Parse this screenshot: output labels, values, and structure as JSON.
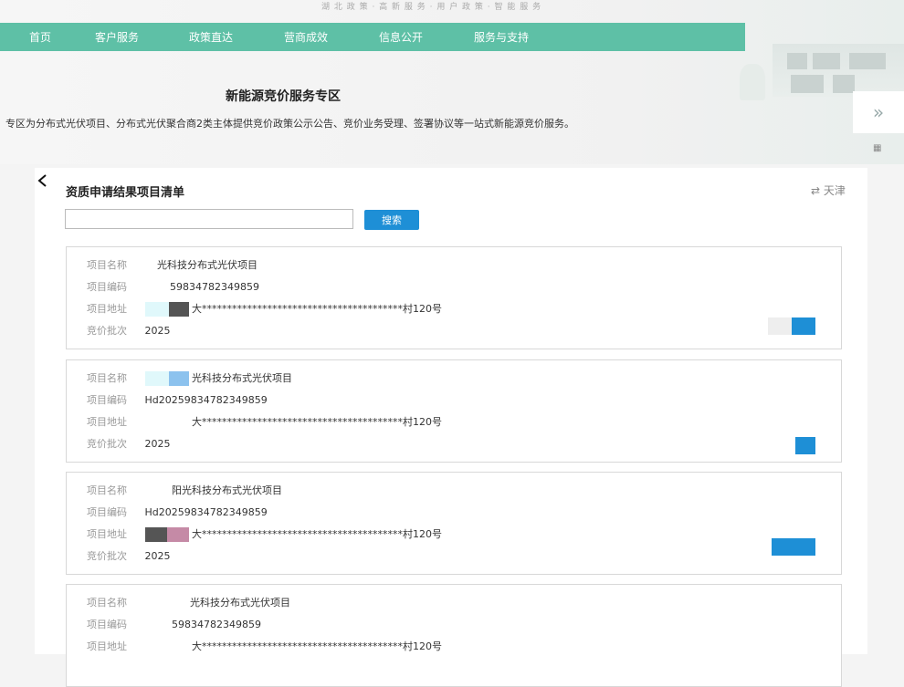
{
  "header": {
    "top_links": "湖 北 政 策 · 高 新 服 务 · 用 户 政 策 · 智 能 服 务"
  },
  "nav": {
    "items": [
      {
        "label": "首页"
      },
      {
        "label": "客户服务"
      },
      {
        "label": "政策直达"
      },
      {
        "label": "营商成效"
      },
      {
        "label": "信息公开"
      },
      {
        "label": "服务与支持"
      }
    ]
  },
  "zone": {
    "title": "新能源竞价服务专区",
    "description": "专区为分布式光伏项目、分布式光伏聚合商2类主体提供竞价政策公示公告、竞价业务受理、签署协议等一站式新能源竞价服务。"
  },
  "side": {
    "arrow": "»",
    "qr": "▦"
  },
  "panel": {
    "title": "资质申请结果项目清单",
    "region": "⇄ 天津",
    "search_placeholder": "",
    "search_button": "搜索"
  },
  "labels": {
    "name": "项目名称",
    "code": "项目编码",
    "address": "项目地址",
    "batch": "竞价批次"
  },
  "projects": [
    {
      "name": "光科技分布式光伏项目",
      "code": "59834782349859",
      "address": "大****************************************村120号",
      "batch": "2025"
    },
    {
      "name": "光科技分布式光伏项目",
      "code": "Hd20259834782349859",
      "address": "大****************************************村120号",
      "batch": "2025"
    },
    {
      "name": "阳光科技分布式光伏项目",
      "code": "Hd20259834782349859",
      "address": "大****************************************村120号",
      "batch": "2025"
    },
    {
      "name": "光科技分布式光伏项目",
      "code": "59834782349859",
      "address": "大****************************************村120号",
      "batch": ""
    }
  ],
  "colors": {
    "nav": "#5ec0a6",
    "accent": "#1e8fd6"
  }
}
